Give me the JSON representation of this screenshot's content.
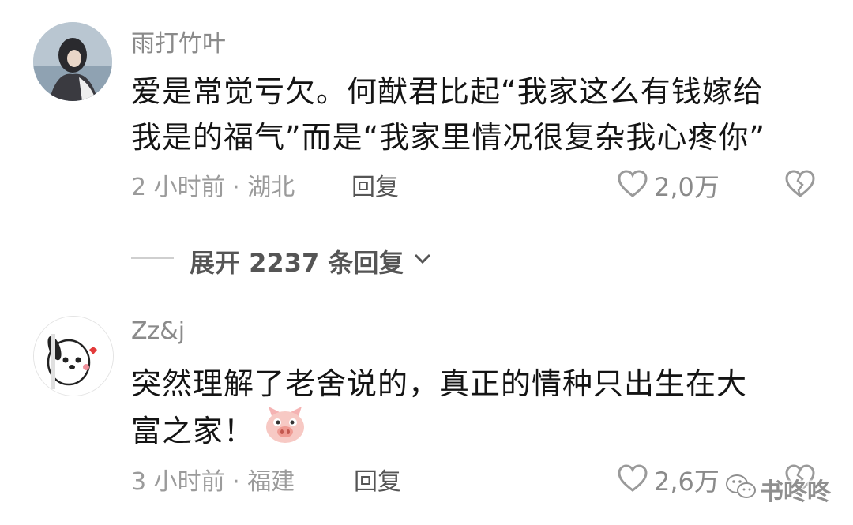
{
  "comments": [
    {
      "username": "雨打竹叶",
      "lines": [
        "爱是常觉亏欠。何猷君比起“我家这么有钱嫁给",
        "我是的福气”而是“我家里情况很复杂我心疼你”"
      ],
      "time": "2 小时前 · 湖北",
      "reply_label": "回复",
      "likes": "2,0万"
    },
    {
      "username": "Zz&j",
      "lines": [
        "突然理解了老舍说的，真正的情种只出生在大",
        "富之家！"
      ],
      "time": "3 小时前 · 福建",
      "reply_label": "回复",
      "likes": "2,6万",
      "emoji": "pig-face-emoji"
    }
  ],
  "expand_label": "展开 2237 条回复",
  "watermark": "书咚咚",
  "icons": [
    "heart-outline-icon",
    "broken-heart-icon",
    "chevron-down-icon",
    "wechat-icon"
  ]
}
